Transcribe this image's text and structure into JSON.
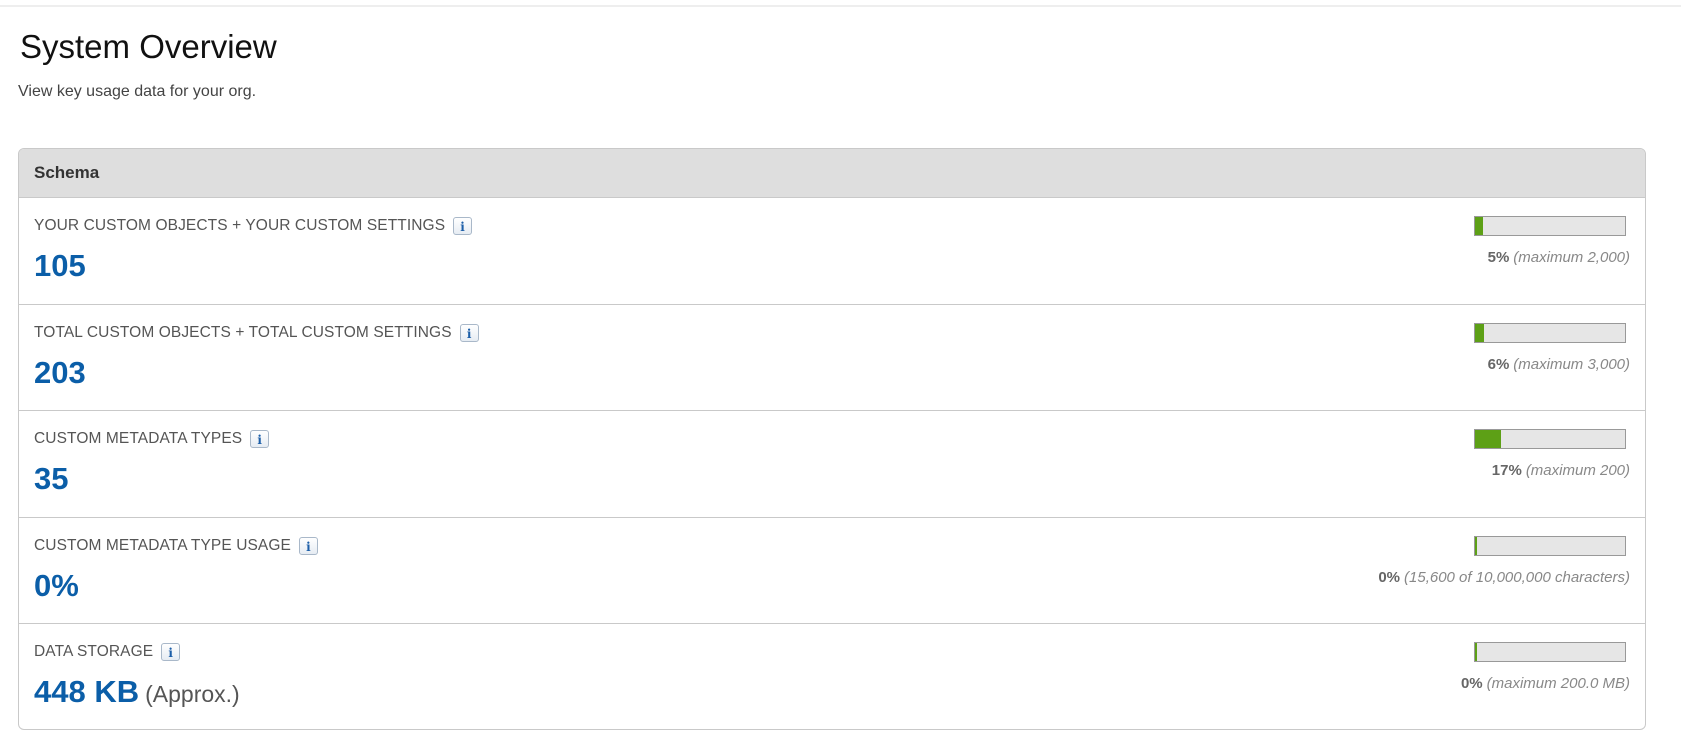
{
  "page": {
    "title": "System Overview",
    "subtitle": "View key usage data for your org."
  },
  "schema": {
    "header": "Schema",
    "rows": [
      {
        "label": "YOUR CUSTOM OBJECTS + YOUR CUSTOM SETTINGS",
        "value": "105",
        "suffix": "",
        "percent_text": "5%",
        "detail": "(maximum 2,000)",
        "fill_fraction": 0.05,
        "info_icon": "info-icon"
      },
      {
        "label": "TOTAL CUSTOM OBJECTS + TOTAL CUSTOM SETTINGS",
        "value": "203",
        "suffix": "",
        "percent_text": "6%",
        "detail": "(maximum 3,000)",
        "fill_fraction": 0.06,
        "info_icon": "info-icon"
      },
      {
        "label": "CUSTOM METADATA TYPES",
        "value": "35",
        "suffix": "",
        "percent_text": "17%",
        "detail": "(maximum 200)",
        "fill_fraction": 0.17,
        "info_icon": "info-icon"
      },
      {
        "label": "CUSTOM METADATA TYPE USAGE",
        "value": "0%",
        "suffix": "",
        "percent_text": "0%",
        "detail": "(15,600 of 10,000,000 characters)",
        "fill_fraction": 0.0,
        "info_icon": "info-icon"
      },
      {
        "label": "DATA STORAGE",
        "value": "448 KB",
        "suffix": "(Approx.)",
        "percent_text": "0%",
        "detail": "(maximum 200.0 MB)",
        "fill_fraction": 0.0,
        "info_icon": "info-icon"
      }
    ]
  },
  "colors": {
    "value_blue": "#0b5ea8",
    "bar_fill_green": "#5da016",
    "bar_track": "#e6e6e6",
    "header_bg": "#dedede"
  }
}
